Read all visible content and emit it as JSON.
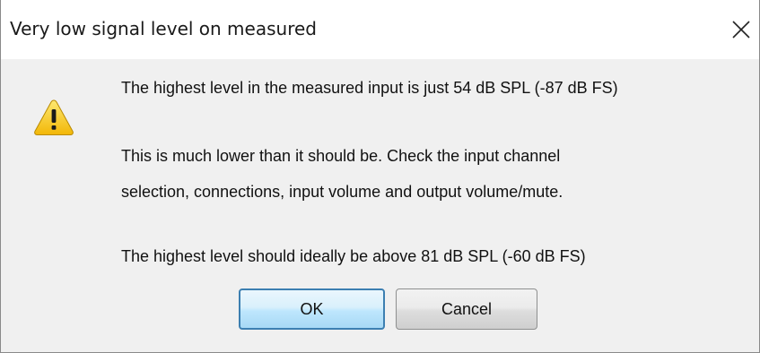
{
  "dialog": {
    "title": "Very low signal level on measured",
    "close_icon": "close-x-icon",
    "warning_icon": "warning-triangle-icon",
    "message_line1": "The highest level in the measured input is just 54 dB SPL (-87 dB FS)",
    "message_line2": "This is much lower than it should be. Check the input channel",
    "message_line3": "selection, connections, input volume and output volume/mute.",
    "message_line4": "The highest level should ideally be above 81 dB SPL (-60 dB FS)",
    "ok_label": "OK",
    "cancel_label": "Cancel"
  },
  "colors": {
    "titlebar_bg": "#ffffff",
    "body_bg": "#f0f0f0",
    "warning_yellow": "#f7d11e",
    "default_button_border": "#3c7fb1"
  }
}
